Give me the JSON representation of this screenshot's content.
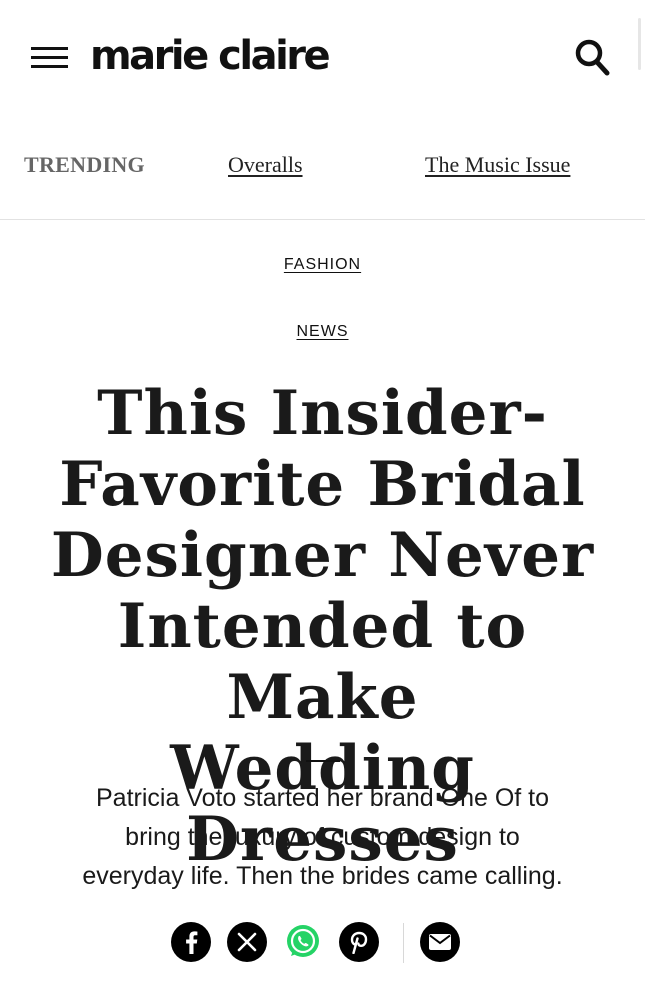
{
  "header": {
    "logo": "marie claire",
    "menu_icon": "hamburger-menu-icon",
    "search_icon": "search-icon"
  },
  "trending": {
    "label": "TRENDING",
    "links": [
      "Overalls",
      "The Music Issue"
    ]
  },
  "article": {
    "category": "FASHION",
    "subcategory": "NEWS",
    "headline_lines": [
      "This Insider-",
      "Favorite Bridal",
      "Designer Never",
      "Intended to Make",
      "Wedding Dresses"
    ],
    "dek_lines": [
      "Patricia Voto started her brand One Of to",
      "bring the luxury of custom design to",
      "everyday life. Then the brides came calling."
    ]
  },
  "share": {
    "icons": [
      "facebook-icon",
      "x-twitter-icon",
      "whatsapp-icon",
      "pinterest-icon",
      "email-icon"
    ],
    "whatsapp_color": "#25D366",
    "button_color": "#000000"
  }
}
